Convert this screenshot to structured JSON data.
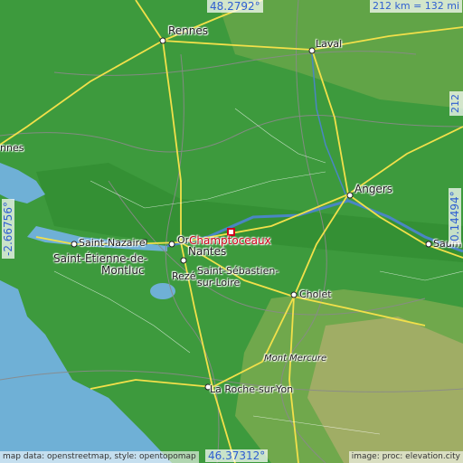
{
  "map": {
    "colors": {
      "sea": "#6fb0d6",
      "land": "#3d9a3d",
      "lowland": "#2f8a2f",
      "hills": "#b7b75e",
      "highlands": "#c8b17a",
      "roads": "#f2e04a",
      "borders": "#8a8a8a",
      "rivers": "#4a86c4",
      "focus": "#d0001a",
      "coords": "#2f5fd1"
    },
    "coords": {
      "top": "48.2792°",
      "bottom": "46.37312°",
      "left": "-2.66756°",
      "right": "0.14494°",
      "scale_h": "212 km = 132 mi",
      "scale_v": "212 km = 132 mi"
    },
    "focus_label": "Champtoceaux",
    "cities": {
      "rennes": "Rennes",
      "laval": "Laval",
      "angers": "Angers",
      "nantes": "Nantes",
      "saint_nazaire": "Saint-Nazaire",
      "saint_etienne": "Saint-Étienne-de-",
      "montluc": "Montluc",
      "saint_sebastien": "Saint-Sébastien-",
      "sur_loire": "sur-Loire",
      "reze": "Rezé",
      "cholet": "Cholet",
      "mont_mercure": "Mont Mercure",
      "la_roche": "La Roche-sur-Yon",
      "saumur": "Saum",
      "vannes": "nnes",
      "orvault": "Or"
    },
    "attribution": {
      "left": "map data: openstreetmap, style: opentopomap",
      "right": "image: proc: elevation.city"
    }
  }
}
